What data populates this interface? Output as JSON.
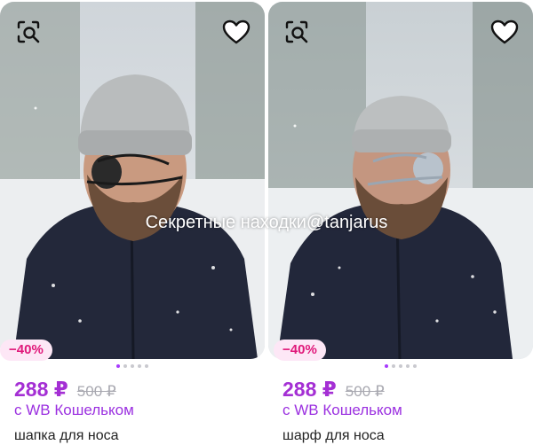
{
  "watermark": "Секретные находки@tanjarus",
  "colors": {
    "price": "#a42fd4",
    "discount_bg": "#fde7f6",
    "discount_text": "#e0187a",
    "dot_active": "#a73afd"
  },
  "cards": [
    {
      "discount": "−40%",
      "price": "288 ₽",
      "old_price": "500 ₽",
      "wallet": "с WB Кошельком",
      "name": "шапка для носа",
      "similar_icon": "image-search-icon",
      "favorite_icon": "heart-outline-icon",
      "photo_index": 1,
      "photo_count": 5
    },
    {
      "discount": "−40%",
      "price": "288 ₽",
      "old_price": "500 ₽",
      "wallet": "с WB Кошельком",
      "name": "шарф для носа",
      "similar_icon": "image-search-icon",
      "favorite_icon": "heart-outline-icon",
      "photo_index": 1,
      "photo_count": 5
    }
  ]
}
